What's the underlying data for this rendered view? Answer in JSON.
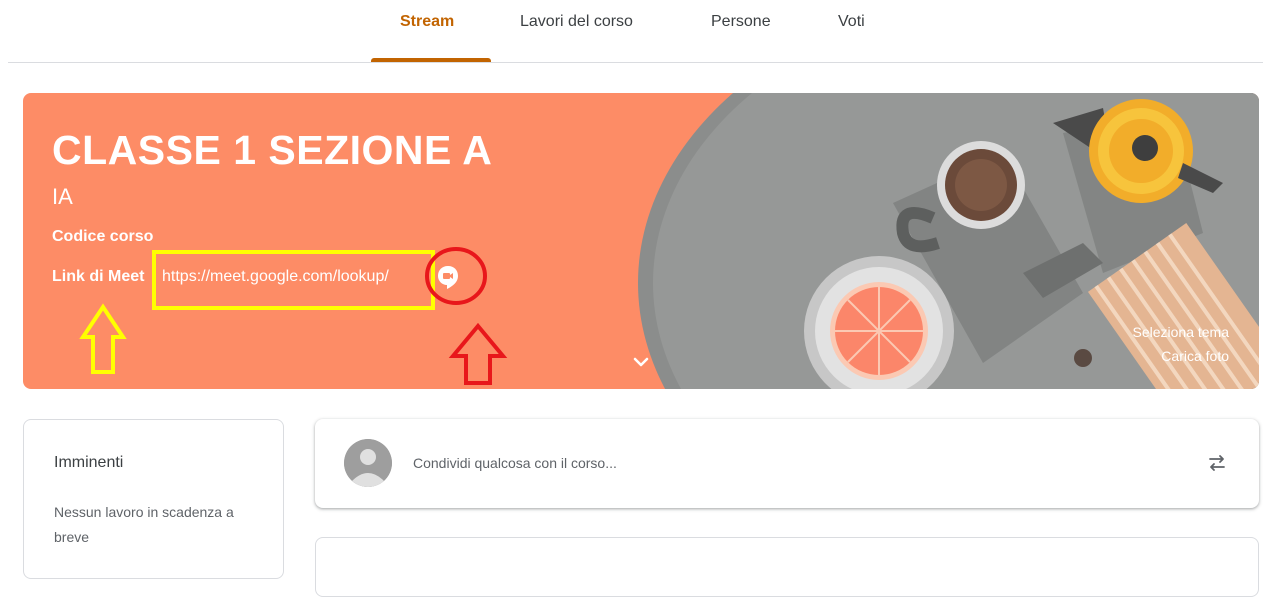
{
  "nav": {
    "tabs": [
      {
        "label": "Stream",
        "active": true
      },
      {
        "label": "Lavori del corso",
        "active": false
      },
      {
        "label": "Persone",
        "active": false
      },
      {
        "label": "Voti",
        "active": false
      }
    ]
  },
  "banner": {
    "class_name": "CLASSE 1 SEZIONE A",
    "section": "IA",
    "course_code_label": "Codice corso",
    "meet_label": "Link di Meet",
    "meet_link": "https://meet.google.com/lookup/",
    "select_theme": "Seleziona tema",
    "upload_photo": "Carica foto",
    "background_color": "#fd8c66"
  },
  "upcoming": {
    "title": "Imminenti",
    "empty_text": "Nessun lavoro in scadenza a breve"
  },
  "share": {
    "placeholder": "Condividi qualcosa con il corso..."
  },
  "colors": {
    "accent": "#c26401",
    "annotation_yellow": "#ffff00",
    "annotation_red": "#e8171b"
  },
  "icons": [
    "meet-video-icon",
    "chevron-down-icon",
    "avatar-icon",
    "repost-icon"
  ]
}
